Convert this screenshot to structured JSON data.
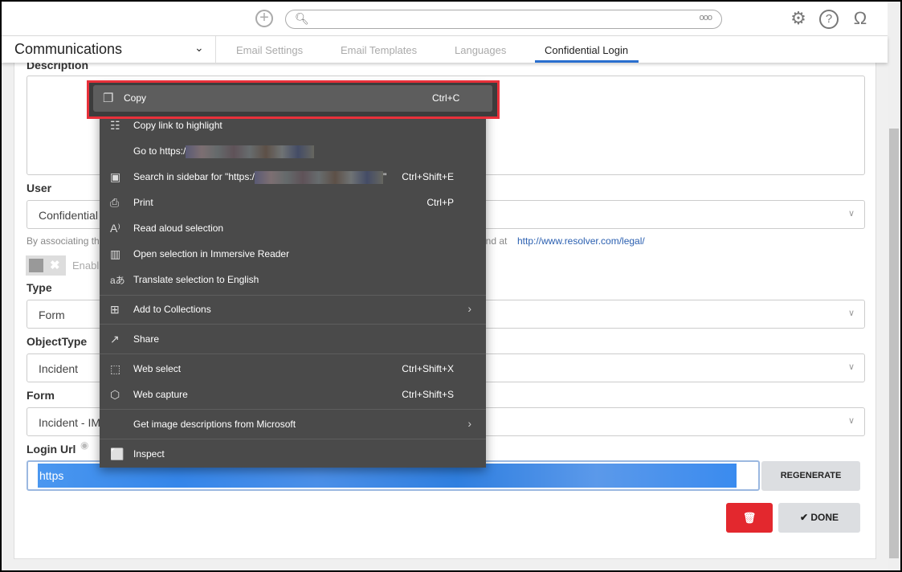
{
  "topbar": {
    "icons": [
      "plus-circle-icon",
      "search-icon",
      "more-icon",
      "gear-icon",
      "help-icon",
      "user-icon"
    ],
    "search_more": "ooo"
  },
  "module": {
    "title": "Communications"
  },
  "tabs": [
    {
      "label": "Email Settings"
    },
    {
      "label": "Email Templates"
    },
    {
      "label": "Languages"
    },
    {
      "label": "Confidential Login",
      "active": true
    }
  ],
  "form": {
    "description_label": "Description",
    "user_label": "User",
    "user_value": "Confidential",
    "help_text": "By associating th",
    "help_text_end": "und at",
    "help_link": "http://www.resolver.com/legal/",
    "enable_label": "Enabl",
    "type_label": "Type",
    "type_value": "Form",
    "objecttype_label": "ObjectType",
    "objecttype_value": "Incident",
    "form_label": "Form",
    "form_value": "Incident - IM",
    "login_url_label": "Login Url",
    "login_url_value": "https",
    "regenerate": "REGENERATE",
    "done": "DONE"
  },
  "context_menu": {
    "copy": {
      "label": "Copy",
      "shortcut": "Ctrl+C"
    },
    "items": [
      {
        "label": "Copy link to highlight",
        "icon": "copy-link-icon"
      },
      {
        "label": "Go to https:/"
      },
      {
        "label": "Search in sidebar for \"https:/",
        "label_end": "\"",
        "shortcut": "Ctrl+Shift+E",
        "icon": "sidebar-search-icon"
      },
      {
        "label": "Print",
        "shortcut": "Ctrl+P",
        "icon": "print-icon"
      },
      {
        "label": "Read aloud selection",
        "icon": "read-aloud-icon"
      },
      {
        "label": "Open selection in Immersive Reader",
        "icon": "immersive-reader-icon"
      },
      {
        "label": "Translate selection to English",
        "icon": "translate-icon"
      },
      {
        "label": "Add to Collections",
        "icon": "collections-icon",
        "submenu": true
      },
      {
        "label": "Share",
        "icon": "share-icon"
      },
      {
        "label": "Web select",
        "shortcut": "Ctrl+Shift+X",
        "icon": "web-select-icon"
      },
      {
        "label": "Web capture",
        "shortcut": "Ctrl+Shift+S",
        "icon": "web-capture-icon"
      },
      {
        "label": "Get image descriptions from Microsoft",
        "submenu": true
      },
      {
        "label": "Inspect",
        "icon": "inspect-icon"
      }
    ]
  },
  "colors": {
    "accent": "#2a6fcf",
    "highlight_outline": "#e8303a",
    "delete": "#e3282e",
    "menu_bg": "#4a4a4a"
  }
}
